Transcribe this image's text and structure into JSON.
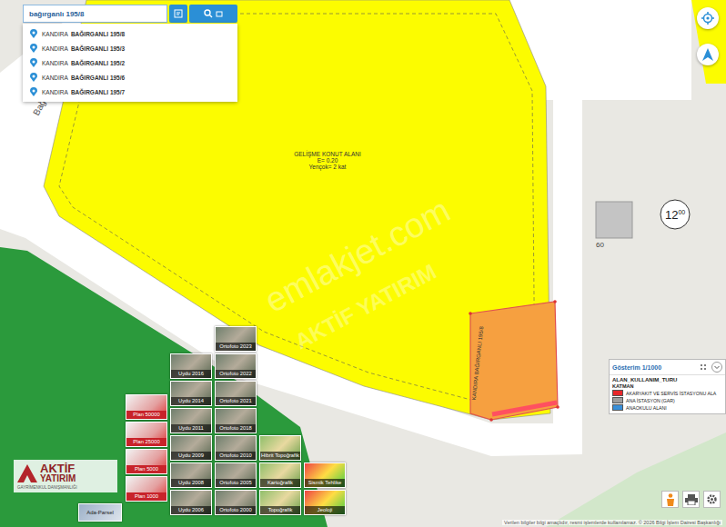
{
  "search": {
    "value": "bağırganlı 195/8",
    "results": [
      {
        "district": "KANDIRA",
        "name": "BAĞIRGANLI 195/8"
      },
      {
        "district": "KANDIRA",
        "name": "BAĞIRGANLI 195/3"
      },
      {
        "district": "KANDIRA",
        "name": "BAĞIRGANLI 195/2"
      },
      {
        "district": "KANDIRA",
        "name": "BAĞIRGANLI 195/6"
      },
      {
        "district": "KANDIRA",
        "name": "BAĞIRGANLI 195/7"
      }
    ]
  },
  "map": {
    "zone": {
      "title": "GELİŞME KONUT ALANI",
      "density": "E= 0.20",
      "height": "Yençok= 2 kat"
    },
    "parcel_label": "KANDIRA BAĞIRGANLI 195/8",
    "road_label": "Bağ",
    "road_width": "12",
    "road_width_decimals": "00",
    "building_number": "60",
    "watermark": [
      "emlakjet.com",
      "AKTİF YATIRIM"
    ]
  },
  "legend": {
    "scale": "Gösterim 1/1000",
    "layer": "ALAN_KULLANIM_TURU",
    "header": "KATMAN",
    "items": [
      {
        "label": "AKARYAKIT VE SERVİS İSTASYONU ALA",
        "color": "#e8262a"
      },
      {
        "label": "ANA İSTASYON (GAR)",
        "color": "#9e9e9e"
      },
      {
        "label": "ANAOKULU ALANI",
        "color": "#3a8fd8"
      }
    ]
  },
  "layers": [
    {
      "label": "Ortofoto 2023",
      "kind": "photo"
    },
    {
      "label": "Uydu 2016",
      "kind": "photo"
    },
    {
      "label": "Ortofoto 2022",
      "kind": "photo"
    },
    {
      "label": "Uydu 2014",
      "kind": "photo"
    },
    {
      "label": "Ortofoto 2021",
      "kind": "photo"
    },
    {
      "label": "Plan 50000",
      "kind": "plan"
    },
    {
      "label": "Uydu 2011",
      "kind": "photo"
    },
    {
      "label": "Ortofoto 2018",
      "kind": "photo"
    },
    {
      "label": "Plan 25000",
      "kind": "plan"
    },
    {
      "label": "Uydu 2009",
      "kind": "photo"
    },
    {
      "label": "Ortofoto 2010",
      "kind": "photo"
    },
    {
      "label": "Hibrit Topoğrafik",
      "kind": "map"
    },
    {
      "label": "Plan 5000",
      "kind": "plan"
    },
    {
      "label": "Uydu 2008",
      "kind": "photo"
    },
    {
      "label": "Ortofoto 2005",
      "kind": "photo"
    },
    {
      "label": "Kartoğrafik",
      "kind": "map"
    },
    {
      "label": "Sismik Tehlike",
      "kind": "hazard"
    },
    {
      "label": "Plan 1000",
      "kind": "plan"
    },
    {
      "label": "Uydu 2006",
      "kind": "photo"
    },
    {
      "label": "Ortofoto 2000",
      "kind": "photo"
    },
    {
      "label": "Topoğrafik",
      "kind": "map"
    },
    {
      "label": "Jeoloji",
      "kind": "hazard"
    }
  ],
  "parcel_button": "Ada-Parsel",
  "logo": {
    "name": "AKTİF",
    "sub": "YATIRIM",
    "tagline": "GAYRİMENKUL DANIŞMANLIĞI"
  },
  "attribution": "Verilen bilgiler bilgi amaçlıdır, resmi işlemlerde kullanılamaz. © 2026 Bilgi İşlem Dairesi Başkanlığı"
}
